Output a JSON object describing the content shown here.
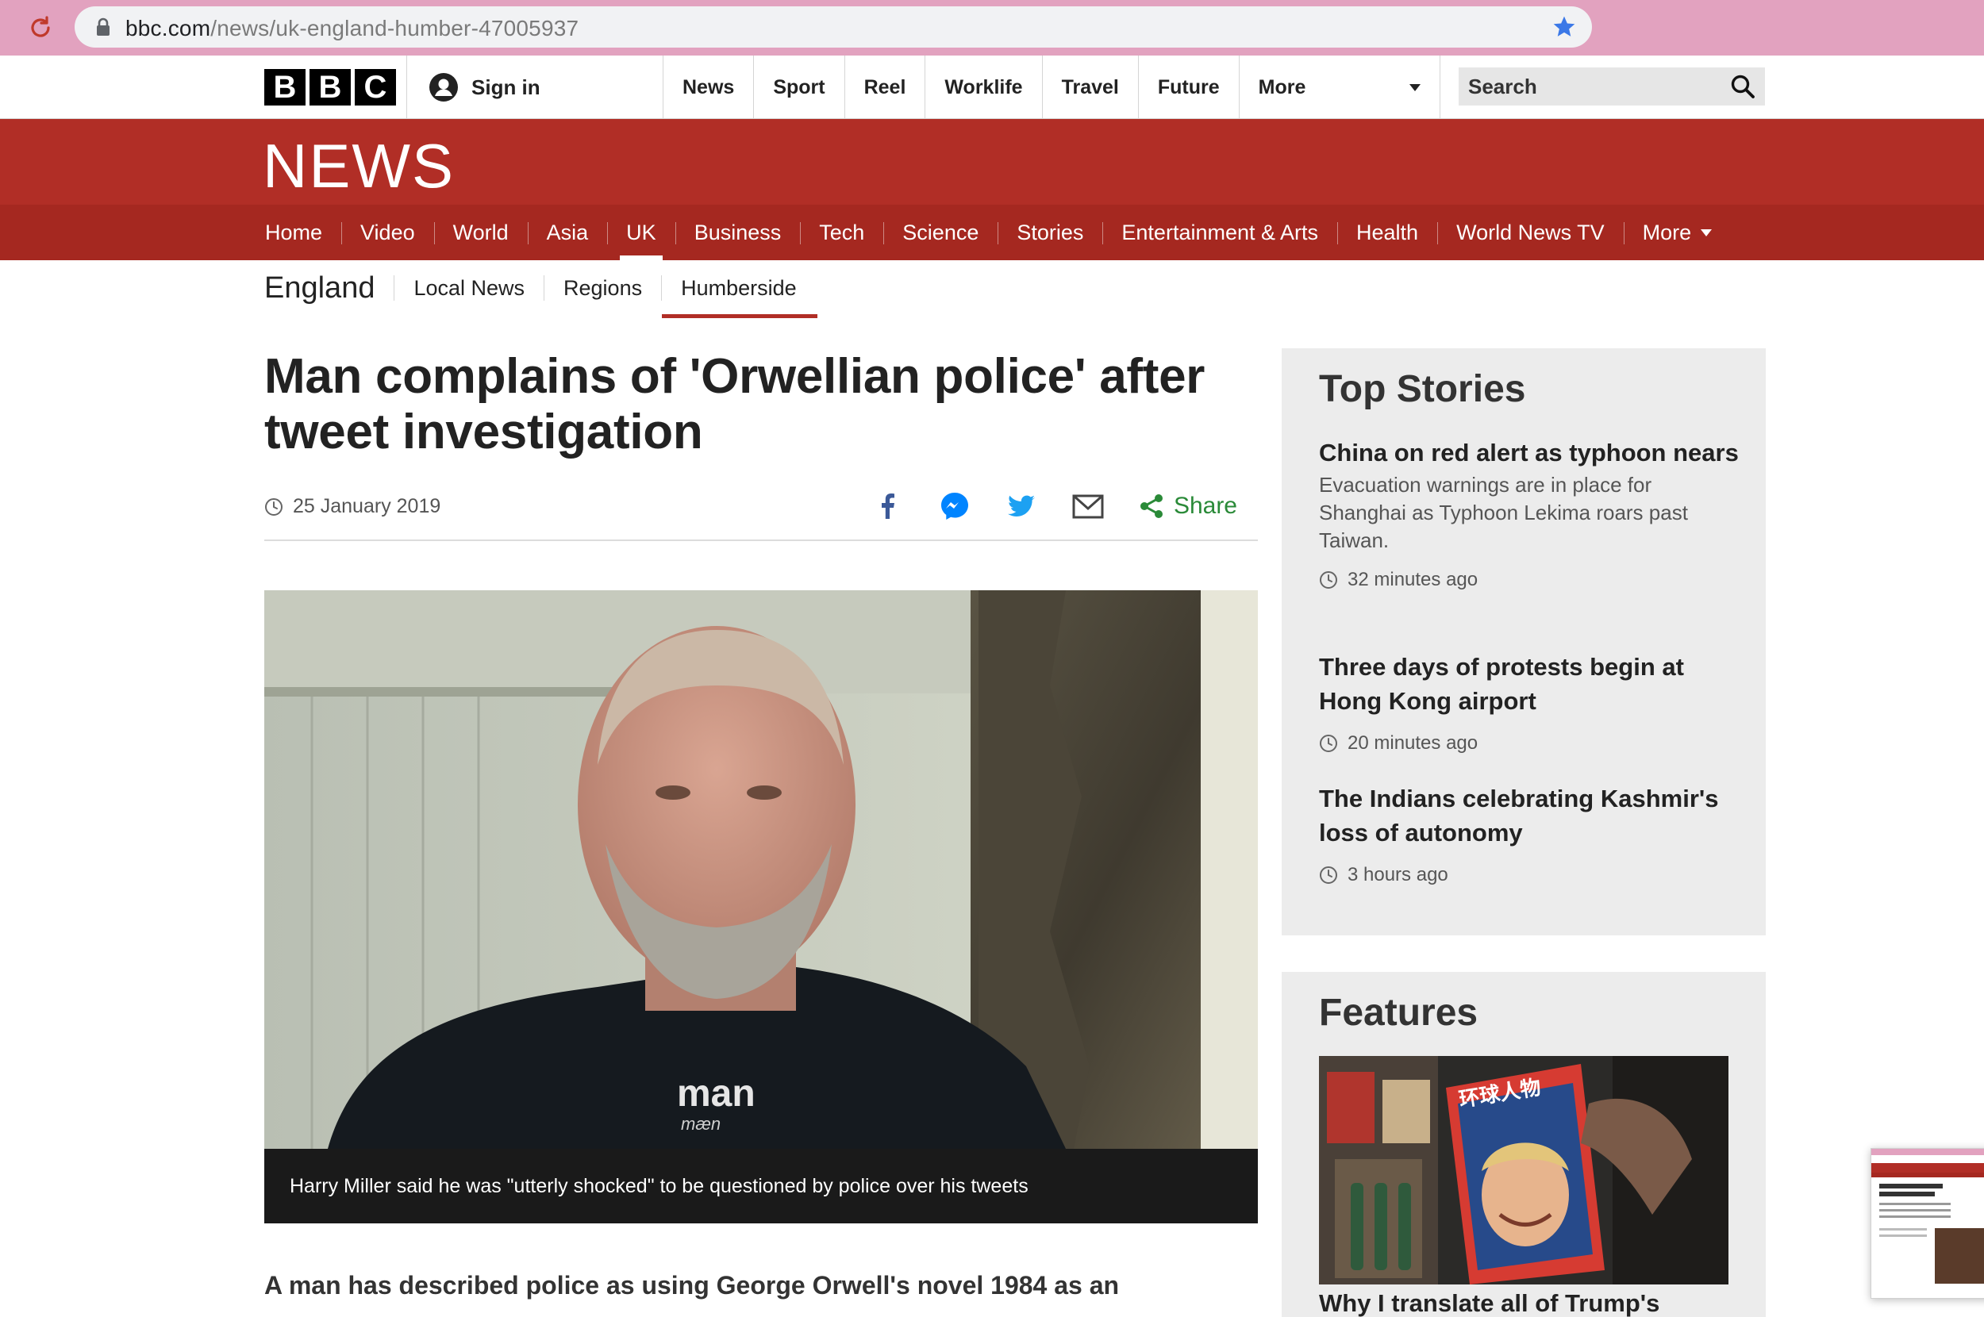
{
  "browser": {
    "url_host": "bbc.com",
    "url_path": "/news/uk-england-humber-47005937"
  },
  "masthead": {
    "logo_letters": [
      "B",
      "B",
      "C"
    ],
    "sign_in": "Sign in",
    "nav": [
      "News",
      "Sport",
      "Reel",
      "Worklife",
      "Travel",
      "Future",
      "More"
    ],
    "search_placeholder": "Search"
  },
  "news_banner": {
    "title": "NEWS"
  },
  "section_nav": {
    "items": [
      "Home",
      "Video",
      "World",
      "Asia",
      "UK",
      "Business",
      "Tech",
      "Science",
      "Stories",
      "Entertainment & Arts",
      "Health",
      "World News TV",
      "More"
    ],
    "active": "UK"
  },
  "sub_nav": {
    "title": "England",
    "items": [
      "Local News",
      "Regions",
      "Humberside"
    ],
    "active": "Humberside"
  },
  "article": {
    "headline": "Man complains of 'Orwellian police' after tweet investigation",
    "date": "25 January 2019",
    "share_label": "Share",
    "shirt_text": "man",
    "shirt_text_sub": "mæn",
    "caption": "Harry Miller said he was \"utterly shocked\" to be questioned by police over his tweets",
    "lead": "A man has described police as using George Orwell's novel 1984 as an"
  },
  "top_stories": {
    "title": "Top Stories",
    "items": [
      {
        "title": "China on red alert as typhoon nears",
        "summary": "Evacuation warnings are in place for Shanghai as Typhoon Lekima roars past Taiwan.",
        "time": "32 minutes ago"
      },
      {
        "title": "Three days of protests begin at Hong Kong airport",
        "summary": "",
        "time": "20 minutes ago"
      },
      {
        "title": "The Indians celebrating Kashmir's loss of autonomy",
        "summary": "",
        "time": "3 hours ago"
      }
    ]
  },
  "features": {
    "title": "Features",
    "magazine_title": "环球人物",
    "headline": "Why I translate all of Trump's"
  },
  "colors": {
    "bbc_red": "#b12e26",
    "section_red": "#a52820",
    "chrome_pink": "#e2a2bf",
    "share_green": "#2a8a38",
    "facebook_blue": "#3b5998",
    "twitter_blue": "#1da1f2"
  },
  "icons": [
    "reload-icon",
    "lock-icon",
    "bookmark-star-icon",
    "account-icon",
    "chevron-down-icon",
    "search-icon",
    "clock-icon",
    "facebook-icon",
    "messenger-icon",
    "twitter-icon",
    "email-icon",
    "share-icon"
  ]
}
